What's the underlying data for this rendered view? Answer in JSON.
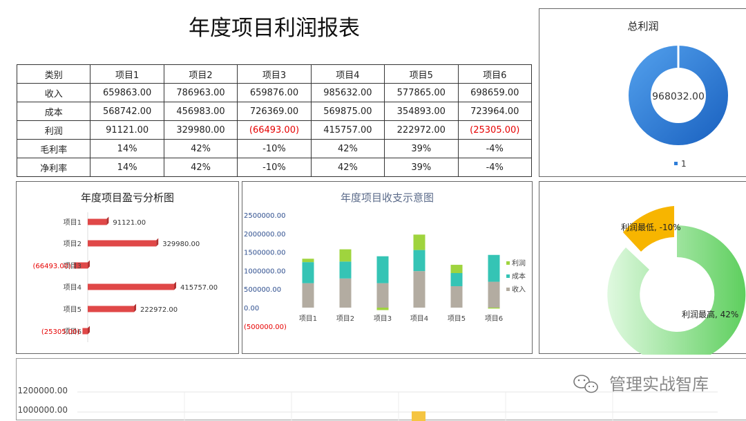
{
  "page": {
    "title": "年度项目利润报表",
    "watermark": "管理实战智库"
  },
  "table": {
    "header": [
      "类别",
      "项目1",
      "项目2",
      "项目3",
      "项目4",
      "项目5",
      "项目6"
    ],
    "rows": [
      [
        "收入",
        "659863.00",
        "786963.00",
        "659876.00",
        "985632.00",
        "577865.00",
        "698659.00"
      ],
      [
        "成本",
        "568742.00",
        "456983.00",
        "726369.00",
        "569875.00",
        "354893.00",
        "723964.00"
      ],
      [
        "利润",
        "91121.00",
        "329980.00",
        "(66493.00)",
        "415757.00",
        "222972.00",
        "(25305.00)"
      ],
      [
        "毛利率",
        "14%",
        "42%",
        "-10%",
        "42%",
        "39%",
        "-4%"
      ],
      [
        "净利率",
        "14%",
        "42%",
        "-10%",
        "42%",
        "39%",
        "-4%"
      ]
    ]
  },
  "chart_data": [
    {
      "type": "pie",
      "variant": "donut",
      "title": "总利润",
      "center_label": "968032.00",
      "legend": [
        "1"
      ],
      "legend_position": "bottom",
      "values": [
        968032
      ],
      "color": "#2f7ed8"
    },
    {
      "type": "bar",
      "orientation": "horizontal",
      "title": "年度项目盈亏分析图",
      "categories": [
        "项目1",
        "项目2",
        "项目3",
        "项目4",
        "项目5",
        "项目6"
      ],
      "values": [
        91121,
        329980,
        -66493,
        415757,
        222972,
        -25305
      ],
      "data_labels": [
        "91121.00",
        "329980.00",
        "(66493.00)",
        "415757.00",
        "222972.00",
        "(25305.00)"
      ],
      "color": "#e04848",
      "negative_label_color": "#e60000"
    },
    {
      "type": "bar",
      "stacked": true,
      "title": "年度项目收支示意图",
      "categories": [
        "项目1",
        "项目2",
        "项目3",
        "项目4",
        "项目5",
        "项目6"
      ],
      "series": [
        {
          "name": "收入",
          "values": [
            659863,
            786963,
            659876,
            985632,
            577865,
            698659
          ],
          "color": "#b3aca1"
        },
        {
          "name": "成本",
          "values": [
            568742,
            456983,
            726369,
            569875,
            354893,
            723964
          ],
          "color": "#35c4b5"
        },
        {
          "name": "利润",
          "values": [
            91121,
            329980,
            -66493,
            415757,
            222972,
            -25305
          ],
          "color": "#9fd43e"
        }
      ],
      "ylim": [
        -500000,
        2500000
      ],
      "yticks": [
        "(500000.00)",
        "0.00",
        "500000.00",
        "1000000.00",
        "1500000.00",
        "2000000.00",
        "2500000.00"
      ],
      "legend_position": "right"
    },
    {
      "type": "pie",
      "variant": "donut",
      "slices": [
        {
          "label": "利润最高, 42%",
          "value": 42,
          "color": "#6fd46f"
        },
        {
          "label": "利润最低, -10%",
          "value": 10,
          "color": "#f7b500"
        }
      ]
    },
    {
      "type": "bar",
      "partial": true,
      "yticks": [
        "1200000.00",
        "1000000.00"
      ]
    }
  ]
}
